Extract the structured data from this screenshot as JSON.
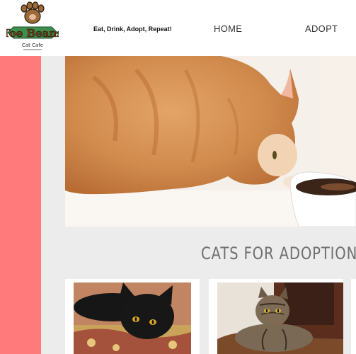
{
  "header": {
    "logo": {
      "text_main": "Toe Beans",
      "text_sub": "Cat Cafe",
      "icon": "paw-icon"
    },
    "tagline": "Eat, Drink, Adopt, Repeat!",
    "nav": [
      {
        "label": "HOME"
      },
      {
        "label": "ADOPT"
      }
    ]
  },
  "hero": {
    "image": "orange-cat-sniffing-coffee-cup-photo"
  },
  "adoption": {
    "title": "CATS FOR ADOPTION",
    "cards": [
      {
        "image": "black-cat-on-blanket-photo"
      },
      {
        "image": "tabby-cat-lying-photo"
      }
    ]
  },
  "colors": {
    "side_strip": "#ff7a7a",
    "page_background": "#ececec",
    "logo_brown": "#8a5a2b",
    "logo_green": "#3e8f4f"
  }
}
